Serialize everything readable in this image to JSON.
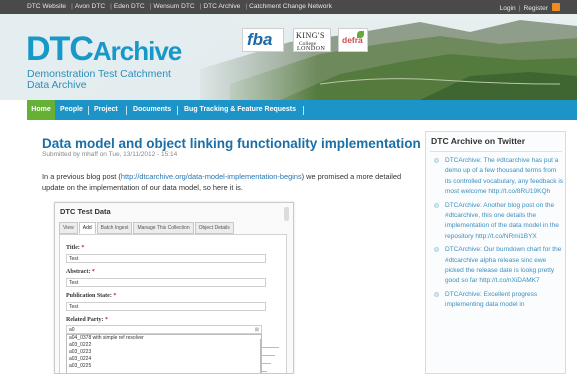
{
  "topbar": {
    "links": [
      "DTC Website",
      "Avon DTC",
      "Eden DTC",
      "Wensum DTC",
      "DTC Archive",
      "Catchment Change Network"
    ],
    "separator": "|",
    "login": "Login",
    "register": "Register"
  },
  "header": {
    "logo_prefix": "DTC",
    "logo_suffix": "Archive",
    "tagline": "Demonstration Test Catchment Data Archive",
    "partners": {
      "fba": "fba",
      "kings_line1": "KING'S",
      "kings_line2": "College",
      "kings_line3": "LONDON",
      "defra": "defra"
    }
  },
  "nav": {
    "items": [
      "Home",
      "People",
      "Project",
      "Documents",
      "Bug Tracking & Feature Requests"
    ]
  },
  "post": {
    "title": "Data model and object linking functionality implementation",
    "submitted": "Submitted by mhaff on Tue, 13/11/2012 - 15:14",
    "intro_before": "In a previous blog post (",
    "intro_link": "http://dtcarchive.org/data-model-implementation-begins",
    "intro_after": ") we promised a more detailed update on the implementation of our data model, so here it is."
  },
  "screenshot": {
    "title": "DTC Test Data",
    "tabs": [
      "View",
      "Add",
      "Batch Ingest",
      "Manage This Collection",
      "Object Details"
    ],
    "fields": {
      "title_label": "Title:",
      "title_value": "Test",
      "abstract_label": "Abstract:",
      "abstract_value": "Test",
      "pubstate_label": "Publication State:",
      "pubstate_value": "Test",
      "party_label": "Related Party:",
      "party_value": "a0",
      "required_mark": "*",
      "clear": "⊠"
    },
    "dropdown_options": [
      "a04_0378 with simple ref resolver",
      "a03_0222",
      "a03_0223",
      "a03_0224",
      "a03_0225"
    ]
  },
  "sidebar": {
    "title": "DTC Archive on Twitter",
    "tweets": [
      "DTCArchive: The #dtcarchive has put a demo up of a few thousand terms from its controlled vocabulary, any feedback is most welcome http://t.co/8RU19KQh",
      "DTCArchive: Another blog post on the #dtcarchive, this one details the implementation of the data model in the repository http://t.co/NRmi1BYX",
      "DTCArchive: Our burndown chart for the #dtcarchive alpha release sinc ewe picked the release date is lookg pretty good so far http://t.co/nXiDAMK7",
      "DTCArchive: Excellent progress implementing data model in"
    ]
  }
}
